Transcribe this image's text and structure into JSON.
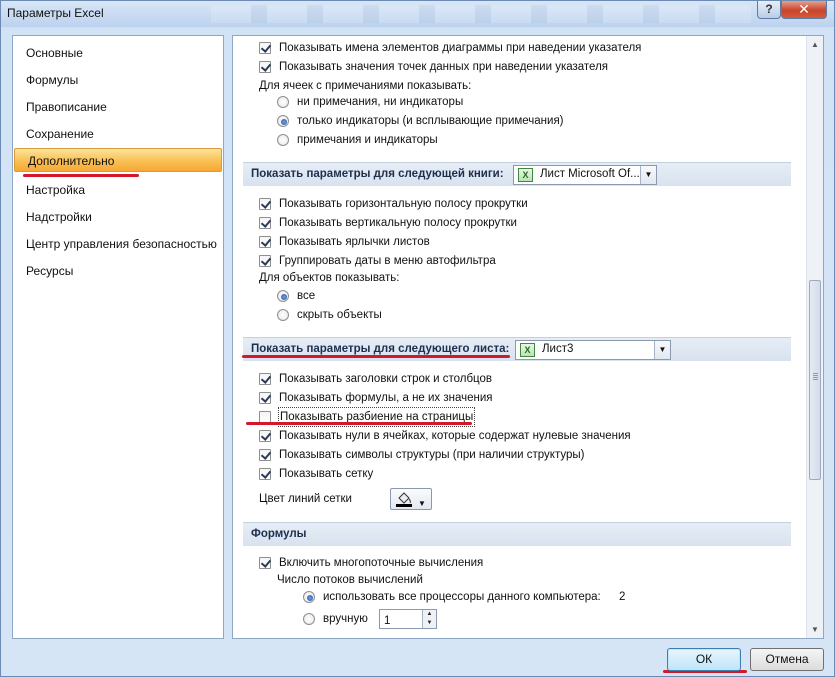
{
  "window": {
    "title": "Параметры Excel",
    "help_label": "?",
    "close_label": "✕"
  },
  "sidebar": {
    "items": [
      {
        "label": "Основные"
      },
      {
        "label": "Формулы"
      },
      {
        "label": "Правописание"
      },
      {
        "label": "Сохранение"
      },
      {
        "label": "Дополнительно",
        "selected": true
      },
      {
        "label": "Настройка"
      },
      {
        "label": "Надстройки"
      },
      {
        "label": "Центр управления безопасностью"
      },
      {
        "label": "Ресурсы"
      }
    ]
  },
  "chart_section": {
    "opt1": {
      "label": "Показывать имена элементов диаграммы при наведении указателя",
      "checked": true
    },
    "opt2": {
      "label": "Показывать значения точек данных при наведении указателя",
      "checked": true
    },
    "comments_label": "Для ячеек с примечаниями показывать:",
    "radio1": {
      "label": "ни примечания, ни индикаторы",
      "checked": false
    },
    "radio2": {
      "label": "только индикаторы (и всплывающие примечания)",
      "checked": true
    },
    "radio3": {
      "label": "примечания и индикаторы",
      "checked": false
    }
  },
  "workbook_section": {
    "title": "Показать параметры для следующей книги:",
    "select_value": "Лист Microsoft Of...",
    "opt1": {
      "label": "Показывать горизонтальную полосу прокрутки",
      "checked": true
    },
    "opt2": {
      "label": "Показывать вертикальную полосу прокрутки",
      "checked": true
    },
    "opt3": {
      "label": "Показывать ярлычки листов",
      "checked": true
    },
    "opt4": {
      "label": "Группировать даты в меню автофильтра",
      "checked": true
    },
    "objects_label": "Для объектов показывать:",
    "radio1": {
      "label": "все",
      "checked": true
    },
    "radio2": {
      "label": "скрыть объекты",
      "checked": false
    }
  },
  "sheet_section": {
    "title": "Показать параметры для следующего листа:",
    "select_value": "Лист3",
    "opt1": {
      "label": "Показывать заголовки строк и столбцов",
      "checked": true
    },
    "opt2": {
      "label": "Показывать формулы, а не их значения",
      "checked": true
    },
    "opt3": {
      "label": "Показывать разбиение на страницы",
      "checked": false
    },
    "opt4": {
      "label": "Показывать нули в ячейках, которые содержат нулевые значения",
      "checked": true
    },
    "opt5": {
      "label": "Показывать символы структуры (при наличии структуры)",
      "checked": true
    },
    "opt6": {
      "label": "Показывать сетку",
      "checked": true
    },
    "grid_color_label": "Цвет линий сетки"
  },
  "formulas_section": {
    "title": "Формулы",
    "opt1": {
      "label": "Включить многопоточные вычисления",
      "checked": true
    },
    "threads_label": "Число потоков вычислений",
    "radio1": {
      "label": "использовать все процессоры данного компьютера:",
      "checked": true,
      "value": "2"
    },
    "radio2": {
      "label": "вручную",
      "checked": false,
      "value": "1"
    }
  },
  "footer": {
    "ok_label": "ОК",
    "cancel_label": "Отмена"
  },
  "colors": {
    "accent_red": "#d3182a",
    "selected_item": "#f9c35a"
  }
}
